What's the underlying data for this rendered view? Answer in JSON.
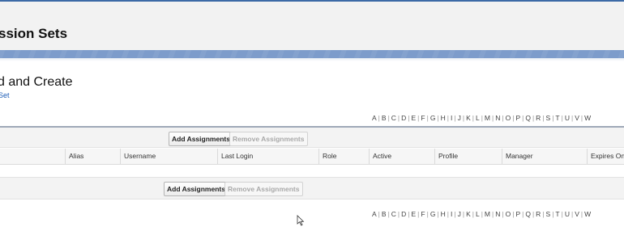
{
  "header": {
    "title": "ssion Sets"
  },
  "section": {
    "title": "d and Create",
    "link": "Set"
  },
  "alphabet": [
    "A",
    "B",
    "C",
    "D",
    "E",
    "F",
    "G",
    "H",
    "I",
    "J",
    "K",
    "L",
    "M",
    "N",
    "O",
    "P",
    "Q",
    "R",
    "S",
    "T",
    "U",
    "V",
    "W"
  ],
  "buttons": {
    "add": "Add Assignments",
    "remove": "Remove Assignments"
  },
  "columns": [
    "Alias",
    "Username",
    "Last Login",
    "Role",
    "Active",
    "Profile",
    "Manager",
    "Expires On"
  ],
  "colors": {
    "accent_band": "#7d9ccb",
    "top_line": "#3c6aa6",
    "link": "#1b5bb5"
  },
  "icons": {
    "cursor": "mouse-pointer-icon"
  }
}
